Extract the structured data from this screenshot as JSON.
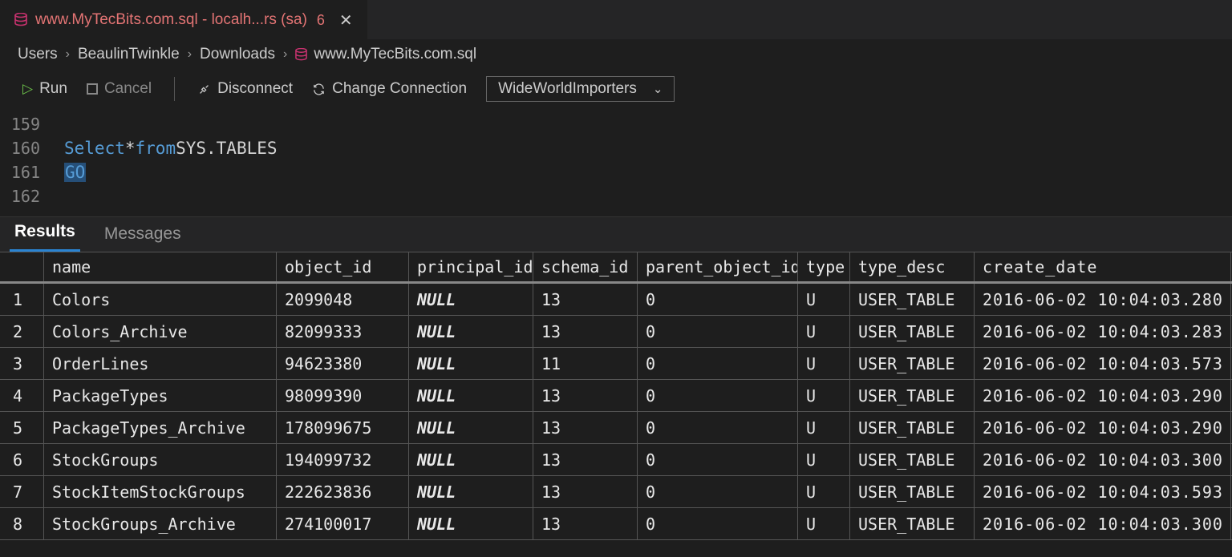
{
  "tab": {
    "title": "www.MyTecBits.com.sql - localh...rs (sa)",
    "badge": "6"
  },
  "breadcrumb": {
    "segments": [
      "Users",
      "BeaulinTwinkle",
      "Downloads"
    ],
    "file": "www.MyTecBits.com.sql"
  },
  "toolbar": {
    "run": "Run",
    "cancel": "Cancel",
    "disconnect": "Disconnect",
    "change_connection": "Change Connection",
    "database": "WideWorldImporters"
  },
  "editor": {
    "lines": [
      {
        "num": "159",
        "tokens": []
      },
      {
        "num": "160",
        "tokens": [
          {
            "t": "Select",
            "cls": "kw"
          },
          {
            "t": " * ",
            "cls": "plain"
          },
          {
            "t": "from",
            "cls": "kw"
          },
          {
            "t": " SYS.TABLES",
            "cls": "plain"
          }
        ]
      },
      {
        "num": "161",
        "tokens": [
          {
            "t": "GO",
            "cls": "kw cursor-box"
          }
        ]
      },
      {
        "num": "162",
        "tokens": []
      }
    ]
  },
  "results_tabs": {
    "results": "Results",
    "messages": "Messages"
  },
  "grid": {
    "columns": [
      "name",
      "object_id",
      "principal_id",
      "schema_id",
      "parent_object_id",
      "type",
      "type_desc",
      "create_date"
    ],
    "rows": [
      {
        "n": "1",
        "name": "Colors",
        "object_id": "2099048",
        "principal_id": "NULL",
        "schema_id": "13",
        "parent_object_id": "0",
        "type": "U",
        "type_desc": "USER_TABLE",
        "create_date": "2016-06-02 10:04:03.280"
      },
      {
        "n": "2",
        "name": "Colors_Archive",
        "object_id": "82099333",
        "principal_id": "NULL",
        "schema_id": "13",
        "parent_object_id": "0",
        "type": "U",
        "type_desc": "USER_TABLE",
        "create_date": "2016-06-02 10:04:03.283"
      },
      {
        "n": "3",
        "name": "OrderLines",
        "object_id": "94623380",
        "principal_id": "NULL",
        "schema_id": "11",
        "parent_object_id": "0",
        "type": "U",
        "type_desc": "USER_TABLE",
        "create_date": "2016-06-02 10:04:03.573"
      },
      {
        "n": "4",
        "name": "PackageTypes",
        "object_id": "98099390",
        "principal_id": "NULL",
        "schema_id": "13",
        "parent_object_id": "0",
        "type": "U",
        "type_desc": "USER_TABLE",
        "create_date": "2016-06-02 10:04:03.290"
      },
      {
        "n": "5",
        "name": "PackageTypes_Archive",
        "object_id": "178099675",
        "principal_id": "NULL",
        "schema_id": "13",
        "parent_object_id": "0",
        "type": "U",
        "type_desc": "USER_TABLE",
        "create_date": "2016-06-02 10:04:03.290"
      },
      {
        "n": "6",
        "name": "StockGroups",
        "object_id": "194099732",
        "principal_id": "NULL",
        "schema_id": "13",
        "parent_object_id": "0",
        "type": "U",
        "type_desc": "USER_TABLE",
        "create_date": "2016-06-02 10:04:03.300"
      },
      {
        "n": "7",
        "name": "StockItemStockGroups",
        "object_id": "222623836",
        "principal_id": "NULL",
        "schema_id": "13",
        "parent_object_id": "0",
        "type": "U",
        "type_desc": "USER_TABLE",
        "create_date": "2016-06-02 10:04:03.593"
      },
      {
        "n": "8",
        "name": "StockGroups_Archive",
        "object_id": "274100017",
        "principal_id": "NULL",
        "schema_id": "13",
        "parent_object_id": "0",
        "type": "U",
        "type_desc": "USER_TABLE",
        "create_date": "2016-06-02 10:04:03.300"
      }
    ]
  }
}
